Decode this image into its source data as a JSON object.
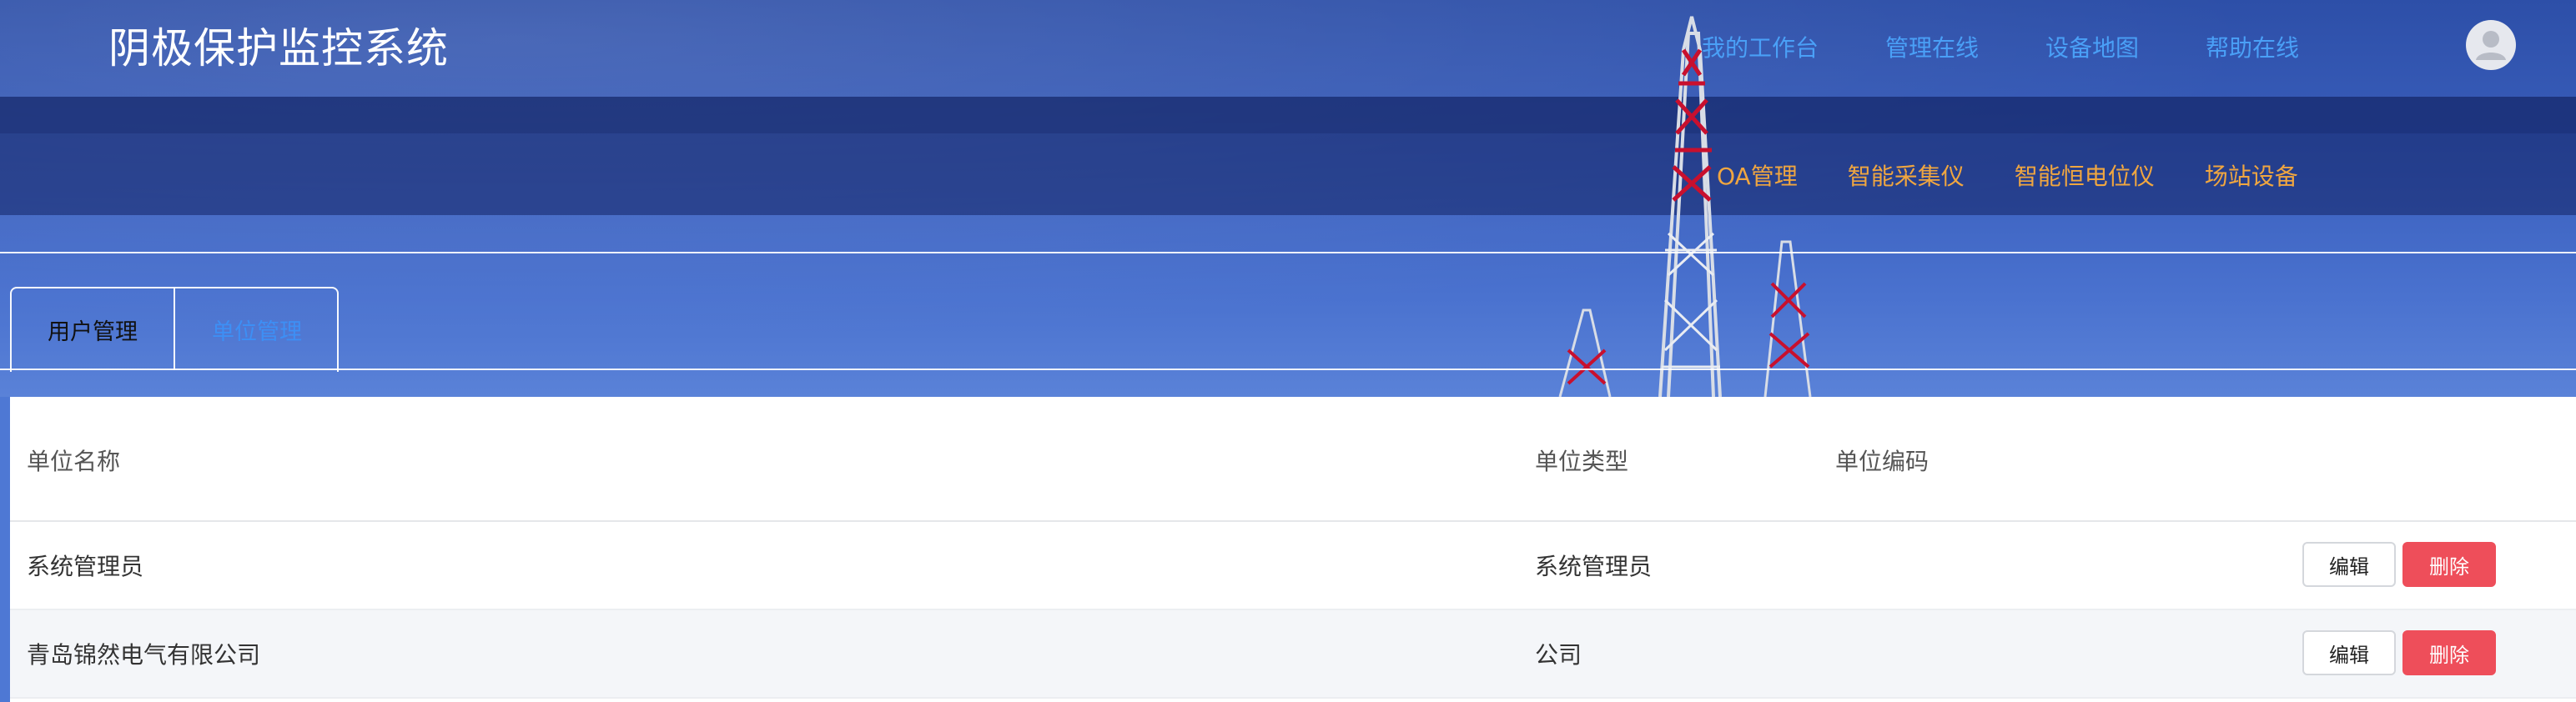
{
  "header": {
    "app_title": "阴极保护监控系统",
    "top_nav": [
      "我的工作台",
      "管理在线",
      "设备地图",
      "帮助在线"
    ],
    "sub_nav": [
      "OA管理",
      "智能采集仪",
      "智能恒电位仪",
      "场站设备"
    ],
    "colors": {
      "top_nav": "#4aa0f7",
      "sub_nav": "#f0a640",
      "banner": "#3a5fbd"
    }
  },
  "tabs": [
    {
      "label": "用户管理",
      "active": false
    },
    {
      "label": "单位管理",
      "active": true
    }
  ],
  "table": {
    "columns": [
      "单位名称",
      "单位类型",
      "单位编码"
    ],
    "rows": [
      {
        "name": "系统管理员",
        "type": "系统管理员",
        "code": "",
        "edit": "编辑",
        "delete": "删除"
      },
      {
        "name": "青岛锦然电气有限公司",
        "type": "公司",
        "code": "",
        "edit": "编辑",
        "delete": "删除"
      }
    ]
  },
  "icons": {
    "avatar": "user-avatar-icon"
  }
}
